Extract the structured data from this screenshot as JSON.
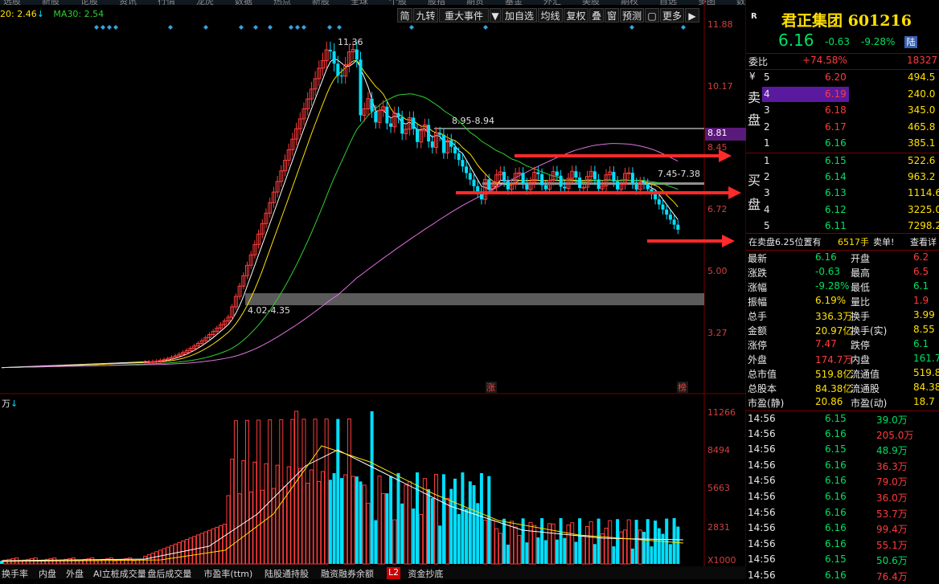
{
  "top_nav": [
    "选股",
    "新股",
    "论股",
    "资讯",
    "行情",
    "龙虎",
    "数据",
    "热点",
    "新股",
    "全球",
    "个股",
    "股指",
    "期货",
    "基金",
    "外汇",
    "美股",
    "期权",
    "自选",
    "多图",
    "数取"
  ],
  "indicators": {
    "ma20": "20: 2.46",
    "ma20_arrow": "↓",
    "ma30": "MA30: 2.54"
  },
  "toolbar": [
    "简",
    "九转",
    "重大事件",
    "▼",
    "加自选",
    "均线",
    "复权",
    "叠",
    "窗",
    "预测",
    "▢",
    "更多",
    "▶"
  ],
  "price_axis": [
    "11.88",
    "10.17",
    "8.81",
    "8.45",
    "6.72",
    "5.00",
    "3.27"
  ],
  "volume_axis": [
    "11266",
    "8494",
    "5663",
    "2831",
    "X1000"
  ],
  "volume_unit": "万",
  "annotations": {
    "high": "11.36",
    "gap_top": "8.95-8.94",
    "gap_mid": "7.45-7.38",
    "gap_low": "4.02-4.35",
    "zhang": "涨",
    "bang": "榜"
  },
  "bottom_tabs": [
    "换手率",
    "内盘",
    "外盘",
    "AI立桩成交量",
    "盘后成交量",
    "市盈率(ttm)",
    "陆股通持股",
    "融资融券余额",
    "L2",
    "资金抄底"
  ],
  "quote": {
    "r_label": "R",
    "name": "君正集团 601216",
    "price": "6.16",
    "change": "-0.63",
    "pct": "-9.28%",
    "lu": "陆",
    "weibi_label": "委比",
    "weibi": "+74.58%",
    "weicha": "18327",
    "sell_label": "卖盘",
    "buy_label": "买盘",
    "yen": "¥",
    "asks": [
      [
        "5",
        "6.20",
        "494.5"
      ],
      [
        "4",
        "6.19",
        "240.0"
      ],
      [
        "3",
        "6.18",
        "345.0"
      ],
      [
        "2",
        "6.17",
        "465.8"
      ],
      [
        "1",
        "6.16",
        "385.1"
      ]
    ],
    "bids": [
      [
        "1",
        "6.15",
        "522.6"
      ],
      [
        "2",
        "6.14",
        "963.2"
      ],
      [
        "3",
        "6.13",
        "1114.6"
      ],
      [
        "4",
        "6.12",
        "3225.0"
      ],
      [
        "5",
        "6.11",
        "7298.2"
      ]
    ],
    "notice": "在卖盘6.25位置有",
    "notice_vol": "6517手",
    "notice_tail": "卖单!",
    "notice_btn": "查看详",
    "stats": [
      [
        "最新",
        "6.16",
        "开盘",
        "6.2"
      ],
      [
        "涨跌",
        "-0.63",
        "最高",
        "6.5"
      ],
      [
        "涨幅",
        "-9.28%",
        "最低",
        "6.1"
      ],
      [
        "振幅",
        "6.19%",
        "量比",
        "1.9"
      ],
      [
        "总手",
        "336.3万",
        "换手",
        "3.99"
      ],
      [
        "金额",
        "20.97亿",
        "换手(实)",
        "8.55"
      ],
      [
        "涨停",
        "7.47",
        "跌停",
        "6.1"
      ],
      [
        "外盘",
        "174.7万",
        "内盘",
        "161.7"
      ],
      [
        "总市值",
        "519.8亿",
        "流通值",
        "519.8"
      ],
      [
        "总股本",
        "84.38亿",
        "流通股",
        "84.38"
      ],
      [
        "市盈(静)",
        "20.86",
        "市盈(动)",
        "18.7"
      ]
    ],
    "ticks": [
      [
        "14:56",
        "6.15",
        "39.0万"
      ],
      [
        "14:56",
        "6.16",
        "205.0万"
      ],
      [
        "14:56",
        "6.15",
        "48.9万"
      ],
      [
        "14:56",
        "6.16",
        "36.3万"
      ],
      [
        "14:56",
        "6.16",
        "79.0万"
      ],
      [
        "14:56",
        "6.16",
        "36.0万"
      ],
      [
        "14:56",
        "6.16",
        "53.7万"
      ],
      [
        "14:56",
        "6.16",
        "99.4万"
      ],
      [
        "14:56",
        "6.16",
        "55.1万"
      ],
      [
        "14:56",
        "6.15",
        "50.6万"
      ],
      [
        "14:56",
        "6.16",
        "76.4万"
      ]
    ]
  },
  "colors": {
    "up": "#ff3b3b",
    "down": "#00e0ff",
    "ma5": "#ffffff",
    "ma10": "#ffe000",
    "ma20": "#30d030",
    "ma60": "#e070e0",
    "arrow": "#ff2a2a"
  }
}
